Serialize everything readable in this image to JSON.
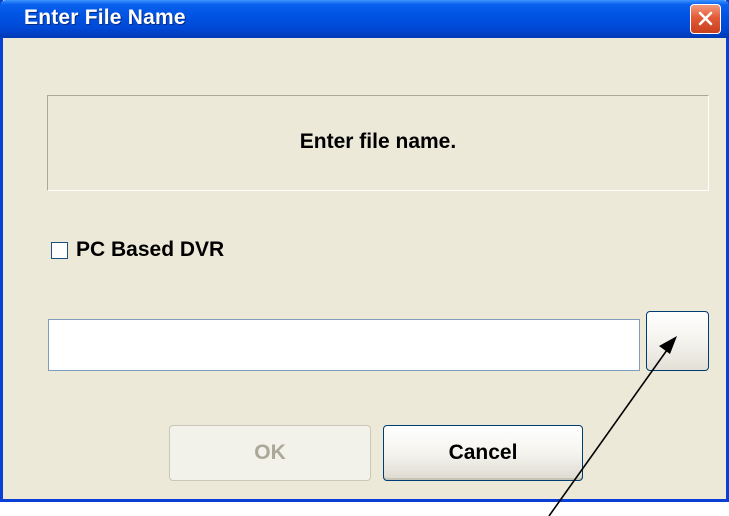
{
  "window": {
    "title": "Enter File Name",
    "close_icon": "close-icon"
  },
  "message": {
    "text": "Enter file name."
  },
  "options": {
    "pc_based_dvr_label": "PC Based DVR",
    "pc_based_dvr_checked": false
  },
  "file_input": {
    "value": "",
    "placeholder": ""
  },
  "browse_button": {
    "label": ""
  },
  "buttons": {
    "ok_label": "OK",
    "ok_enabled": false,
    "cancel_label": "Cancel"
  },
  "colors": {
    "titlebar": "#0054e3",
    "dialog_background": "#ece9d8",
    "close_button": "#e35a37",
    "disabled_text": "#aca899"
  }
}
